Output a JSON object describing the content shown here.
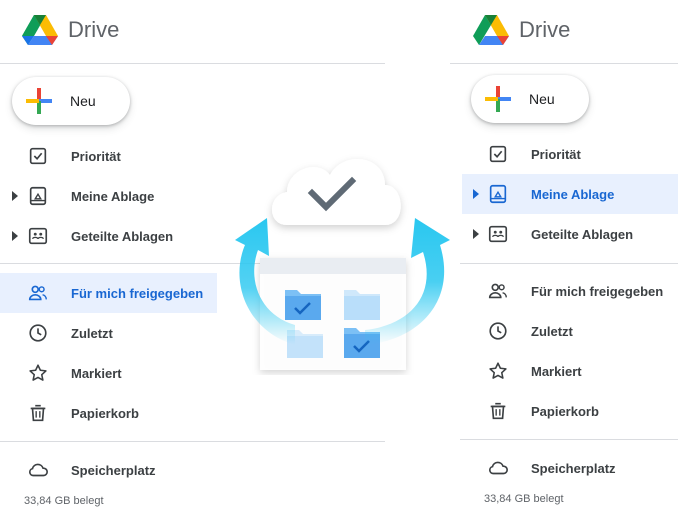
{
  "left": {
    "brand": {
      "name": "Drive"
    },
    "new_button": {
      "label": "Neu"
    },
    "nav": [
      {
        "label": "Priorität",
        "icon": "priority-checkbox-icon",
        "active": false,
        "caret": false
      },
      {
        "label": "Meine Ablage",
        "icon": "my-drive-icon",
        "active": false,
        "caret": true
      },
      {
        "label": "Geteilte Ablagen",
        "icon": "shared-drives-icon",
        "active": false,
        "caret": true
      },
      {
        "label": "Für mich freigegeben",
        "icon": "people-icon",
        "active": true,
        "caret": false
      },
      {
        "label": "Zuletzt",
        "icon": "clock-icon",
        "active": false,
        "caret": false
      },
      {
        "label": "Markiert",
        "icon": "star-icon",
        "active": false,
        "caret": false
      },
      {
        "label": "Papierkorb",
        "icon": "trash-icon",
        "active": false,
        "caret": false
      }
    ],
    "storage": {
      "label": "Speicherplatz",
      "icon": "cloud-icon",
      "usage": "33,84 GB belegt"
    }
  },
  "right": {
    "brand": {
      "name": "Drive"
    },
    "new_button": {
      "label": "Neu"
    },
    "nav": [
      {
        "label": "Priorität",
        "icon": "priority-checkbox-icon",
        "active": false,
        "caret": false
      },
      {
        "label": "Meine Ablage",
        "icon": "my-drive-icon",
        "active": true,
        "caret": true
      },
      {
        "label": "Geteilte Ablagen",
        "icon": "shared-drives-icon",
        "active": false,
        "caret": true
      },
      {
        "label": "Für mich freigegeben",
        "icon": "people-icon",
        "active": false,
        "caret": false
      },
      {
        "label": "Zuletzt",
        "icon": "clock-icon",
        "active": false,
        "caret": false
      },
      {
        "label": "Markiert",
        "icon": "star-icon",
        "active": false,
        "caret": false
      },
      {
        "label": "Papierkorb",
        "icon": "trash-icon",
        "active": false,
        "caret": false
      }
    ],
    "storage": {
      "label": "Speicherplatz",
      "icon": "cloud-icon",
      "usage": "33,84 GB belegt"
    }
  },
  "colors": {
    "accent": "#1967d2",
    "active_bg": "#e8f0fe",
    "arrow": "#29c7f0",
    "folder": "#7cc0f5"
  }
}
